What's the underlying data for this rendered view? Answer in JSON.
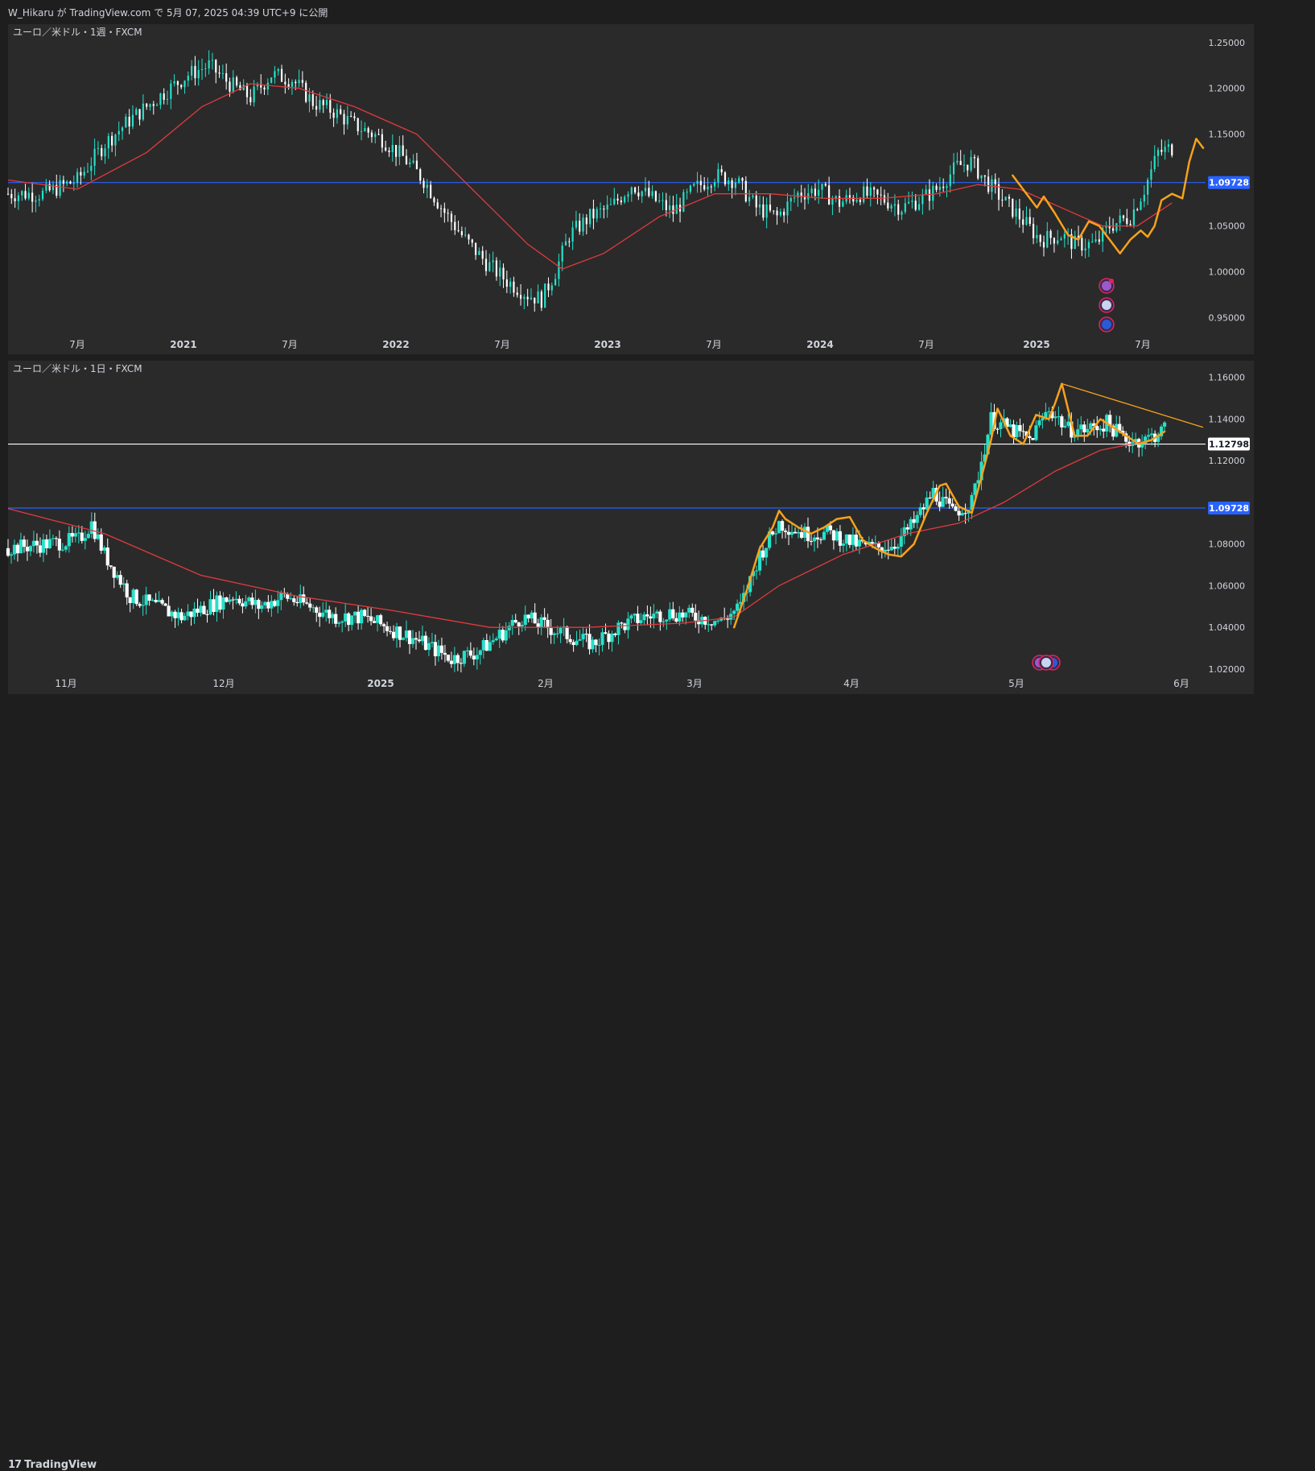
{
  "header": {
    "text": "W_Hikaru が TradingView.com で 5月 07, 2025 04:39 UTC+9 に公開"
  },
  "footer": {
    "logo_mark": "17",
    "logo_text": "TradingView"
  },
  "colors": {
    "background": "#2a2a2a",
    "up_candle": "#26e0c8",
    "down_candle": "#ffffff",
    "ma_line": "#e03a3e",
    "wave_line": "#f7a21b",
    "support_blue": "#2962ff",
    "support_white": "#ffffff"
  },
  "chart_data": [
    {
      "type": "candlestick",
      "title": "ユーロ／米ドル・1週・FXCM",
      "x_ticks": [
        "7月",
        "2021",
        "7月",
        "2022",
        "7月",
        "2023",
        "7月",
        "2024",
        "7月",
        "2025",
        "7月"
      ],
      "x_bold": [
        false,
        true,
        false,
        true,
        false,
        true,
        false,
        true,
        false,
        true,
        false
      ],
      "y_ticks": [
        "1.25000",
        "1.20000",
        "1.15000",
        "1.10000",
        "1.05000",
        "1.00000",
        "0.95000"
      ],
      "y_tick_values": [
        1.25,
        1.2,
        1.15,
        1.1,
        1.05,
        1.0,
        0.95
      ],
      "ylim": [
        0.91,
        1.27
      ],
      "horizontal_line": {
        "value": 1.09728,
        "label": "1.09728",
        "color": "#2962ff"
      },
      "close_path": [
        [
          0,
          1.085
        ],
        [
          10,
          1.085
        ],
        [
          20,
          1.1
        ],
        [
          28,
          1.14
        ],
        [
          35,
          1.165
        ],
        [
          45,
          1.195
        ],
        [
          52,
          1.215
        ],
        [
          58,
          1.225
        ],
        [
          64,
          1.205
        ],
        [
          70,
          1.19
        ],
        [
          76,
          1.215
        ],
        [
          82,
          1.21
        ],
        [
          88,
          1.185
        ],
        [
          94,
          1.175
        ],
        [
          100,
          1.16
        ],
        [
          108,
          1.145
        ],
        [
          114,
          1.125
        ],
        [
          120,
          1.1
        ],
        [
          126,
          1.065
        ],
        [
          132,
          1.035
        ],
        [
          138,
          1.01
        ],
        [
          144,
          0.99
        ],
        [
          150,
          0.975
        ],
        [
          154,
          0.97
        ],
        [
          158,
          1.0
        ],
        [
          162,
          1.04
        ],
        [
          168,
          1.06
        ],
        [
          174,
          1.07
        ],
        [
          180,
          1.095
        ],
        [
          186,
          1.08
        ],
        [
          192,
          1.065
        ],
        [
          198,
          1.09
        ],
        [
          204,
          1.105
        ],
        [
          210,
          1.1
        ],
        [
          216,
          1.07
        ],
        [
          222,
          1.06
        ],
        [
          228,
          1.085
        ],
        [
          234,
          1.09
        ],
        [
          240,
          1.075
        ],
        [
          246,
          1.085
        ],
        [
          252,
          1.08
        ],
        [
          258,
          1.07
        ],
        [
          264,
          1.08
        ],
        [
          268,
          1.09
        ],
        [
          274,
          1.115
        ],
        [
          278,
          1.12
        ],
        [
          282,
          1.1
        ],
        [
          288,
          1.075
        ],
        [
          292,
          1.06
        ],
        [
          298,
          1.035
        ],
        [
          304,
          1.04
        ],
        [
          308,
          1.03
        ],
        [
          314,
          1.03
        ],
        [
          318,
          1.05
        ],
        [
          324,
          1.06
        ],
        [
          328,
          1.09
        ],
        [
          332,
          1.13
        ],
        [
          336,
          1.135
        ]
      ],
      "ma_path": [
        [
          0,
          1.1
        ],
        [
          20,
          1.09
        ],
        [
          40,
          1.13
        ],
        [
          56,
          1.18
        ],
        [
          70,
          1.205
        ],
        [
          84,
          1.2
        ],
        [
          100,
          1.18
        ],
        [
          118,
          1.15
        ],
        [
          134,
          1.09
        ],
        [
          150,
          1.03
        ],
        [
          160,
          1.003
        ],
        [
          172,
          1.02
        ],
        [
          188,
          1.06
        ],
        [
          204,
          1.085
        ],
        [
          220,
          1.085
        ],
        [
          236,
          1.08
        ],
        [
          252,
          1.08
        ],
        [
          268,
          1.085
        ],
        [
          280,
          1.095
        ],
        [
          292,
          1.09
        ],
        [
          304,
          1.07
        ],
        [
          316,
          1.05
        ],
        [
          326,
          1.05
        ],
        [
          336,
          1.075
        ]
      ],
      "wave_path": [
        [
          290,
          1.105
        ],
        [
          294,
          1.085
        ],
        [
          297,
          1.07
        ],
        [
          299,
          1.082
        ],
        [
          302,
          1.065
        ],
        [
          306,
          1.04
        ],
        [
          309,
          1.035
        ],
        [
          312,
          1.055
        ],
        [
          315,
          1.05
        ],
        [
          318,
          1.035
        ],
        [
          321,
          1.02
        ],
        [
          324,
          1.035
        ],
        [
          327,
          1.045
        ],
        [
          329,
          1.038
        ],
        [
          331,
          1.05
        ],
        [
          333,
          1.078
        ],
        [
          336,
          1.085
        ],
        [
          339,
          1.08
        ],
        [
          341,
          1.12
        ],
        [
          343,
          1.145
        ],
        [
          345,
          1.135
        ]
      ]
    },
    {
      "type": "candlestick",
      "title": "ユーロ／米ドル・1日・FXCM",
      "x_ticks": [
        "11月",
        "12月",
        "2025",
        "2月",
        "3月",
        "4月",
        "5月",
        "6月"
      ],
      "x_bold": [
        false,
        false,
        true,
        false,
        false,
        false,
        false,
        false
      ],
      "y_ticks": [
        "1.16000",
        "1.14000",
        "1.12000",
        "1.08000",
        "1.06000",
        "1.04000",
        "1.02000"
      ],
      "y_tick_values": [
        1.16,
        1.14,
        1.12,
        1.08,
        1.06,
        1.04,
        1.02
      ],
      "ylim": [
        1.008,
        1.168
      ],
      "horizontal_lines": [
        {
          "value": 1.12798,
          "label": "1.12798",
          "color": "#ffffff"
        },
        {
          "value": 1.09728,
          "label": "1.09728",
          "color": "#2962ff"
        }
      ],
      "close_path": [
        [
          0,
          1.078
        ],
        [
          12,
          1.08
        ],
        [
          22,
          1.082
        ],
        [
          26,
          1.09
        ],
        [
          30,
          1.075
        ],
        [
          38,
          1.055
        ],
        [
          46,
          1.05
        ],
        [
          54,
          1.045
        ],
        [
          62,
          1.05
        ],
        [
          70,
          1.055
        ],
        [
          78,
          1.05
        ],
        [
          86,
          1.055
        ],
        [
          94,
          1.05
        ],
        [
          102,
          1.045
        ],
        [
          110,
          1.045
        ],
        [
          118,
          1.04
        ],
        [
          126,
          1.035
        ],
        [
          132,
          1.03
        ],
        [
          138,
          1.025
        ],
        [
          146,
          1.028
        ],
        [
          152,
          1.035
        ],
        [
          160,
          1.045
        ],
        [
          168,
          1.04
        ],
        [
          176,
          1.035
        ],
        [
          182,
          1.032
        ],
        [
          190,
          1.04
        ],
        [
          198,
          1.045
        ],
        [
          206,
          1.047
        ],
        [
          214,
          1.045
        ],
        [
          222,
          1.043
        ],
        [
          228,
          1.05
        ],
        [
          234,
          1.075
        ],
        [
          240,
          1.09
        ],
        [
          248,
          1.085
        ],
        [
          256,
          1.085
        ],
        [
          264,
          1.08
        ],
        [
          270,
          1.078
        ],
        [
          276,
          1.08
        ],
        [
          282,
          1.09
        ],
        [
          288,
          1.105
        ],
        [
          294,
          1.095
        ],
        [
          300,
          1.1
        ],
        [
          306,
          1.14
        ],
        [
          312,
          1.135
        ],
        [
          318,
          1.13
        ],
        [
          324,
          1.145
        ],
        [
          330,
          1.135
        ],
        [
          336,
          1.135
        ],
        [
          342,
          1.138
        ],
        [
          348,
          1.13
        ],
        [
          354,
          1.13
        ],
        [
          360,
          1.135
        ]
      ],
      "ma_path": [
        [
          0,
          1.097
        ],
        [
          30,
          1.085
        ],
        [
          60,
          1.065
        ],
        [
          90,
          1.055
        ],
        [
          120,
          1.048
        ],
        [
          150,
          1.04
        ],
        [
          180,
          1.04
        ],
        [
          210,
          1.042
        ],
        [
          226,
          1.045
        ],
        [
          240,
          1.06
        ],
        [
          260,
          1.075
        ],
        [
          280,
          1.085
        ],
        [
          296,
          1.09
        ],
        [
          310,
          1.1
        ],
        [
          326,
          1.115
        ],
        [
          340,
          1.125
        ],
        [
          356,
          1.13
        ]
      ],
      "wave_path": [
        [
          226,
          1.04
        ],
        [
          230,
          1.058
        ],
        [
          234,
          1.078
        ],
        [
          238,
          1.088
        ],
        [
          240,
          1.096
        ],
        [
          242,
          1.092
        ],
        [
          246,
          1.088
        ],
        [
          250,
          1.085
        ],
        [
          254,
          1.088
        ],
        [
          258,
          1.092
        ],
        [
          262,
          1.093
        ],
        [
          266,
          1.082
        ],
        [
          270,
          1.078
        ],
        [
          274,
          1.075
        ],
        [
          278,
          1.074
        ],
        [
          282,
          1.08
        ],
        [
          286,
          1.095
        ],
        [
          290,
          1.108
        ],
        [
          292,
          1.109
        ],
        [
          296,
          1.098
        ],
        [
          300,
          1.095
        ],
        [
          304,
          1.118
        ],
        [
          306,
          1.13
        ],
        [
          308,
          1.145
        ],
        [
          312,
          1.132
        ],
        [
          316,
          1.128
        ],
        [
          320,
          1.142
        ],
        [
          324,
          1.14
        ],
        [
          326,
          1.148
        ],
        [
          328,
          1.157
        ],
        [
          332,
          1.132
        ],
        [
          336,
          1.132
        ],
        [
          340,
          1.14
        ],
        [
          344,
          1.136
        ],
        [
          348,
          1.132
        ],
        [
          352,
          1.128
        ],
        [
          356,
          1.13
        ],
        [
          360,
          1.134
        ]
      ],
      "trendline": [
        [
          328,
          1.157
        ],
        [
          372,
          1.136
        ]
      ]
    }
  ]
}
